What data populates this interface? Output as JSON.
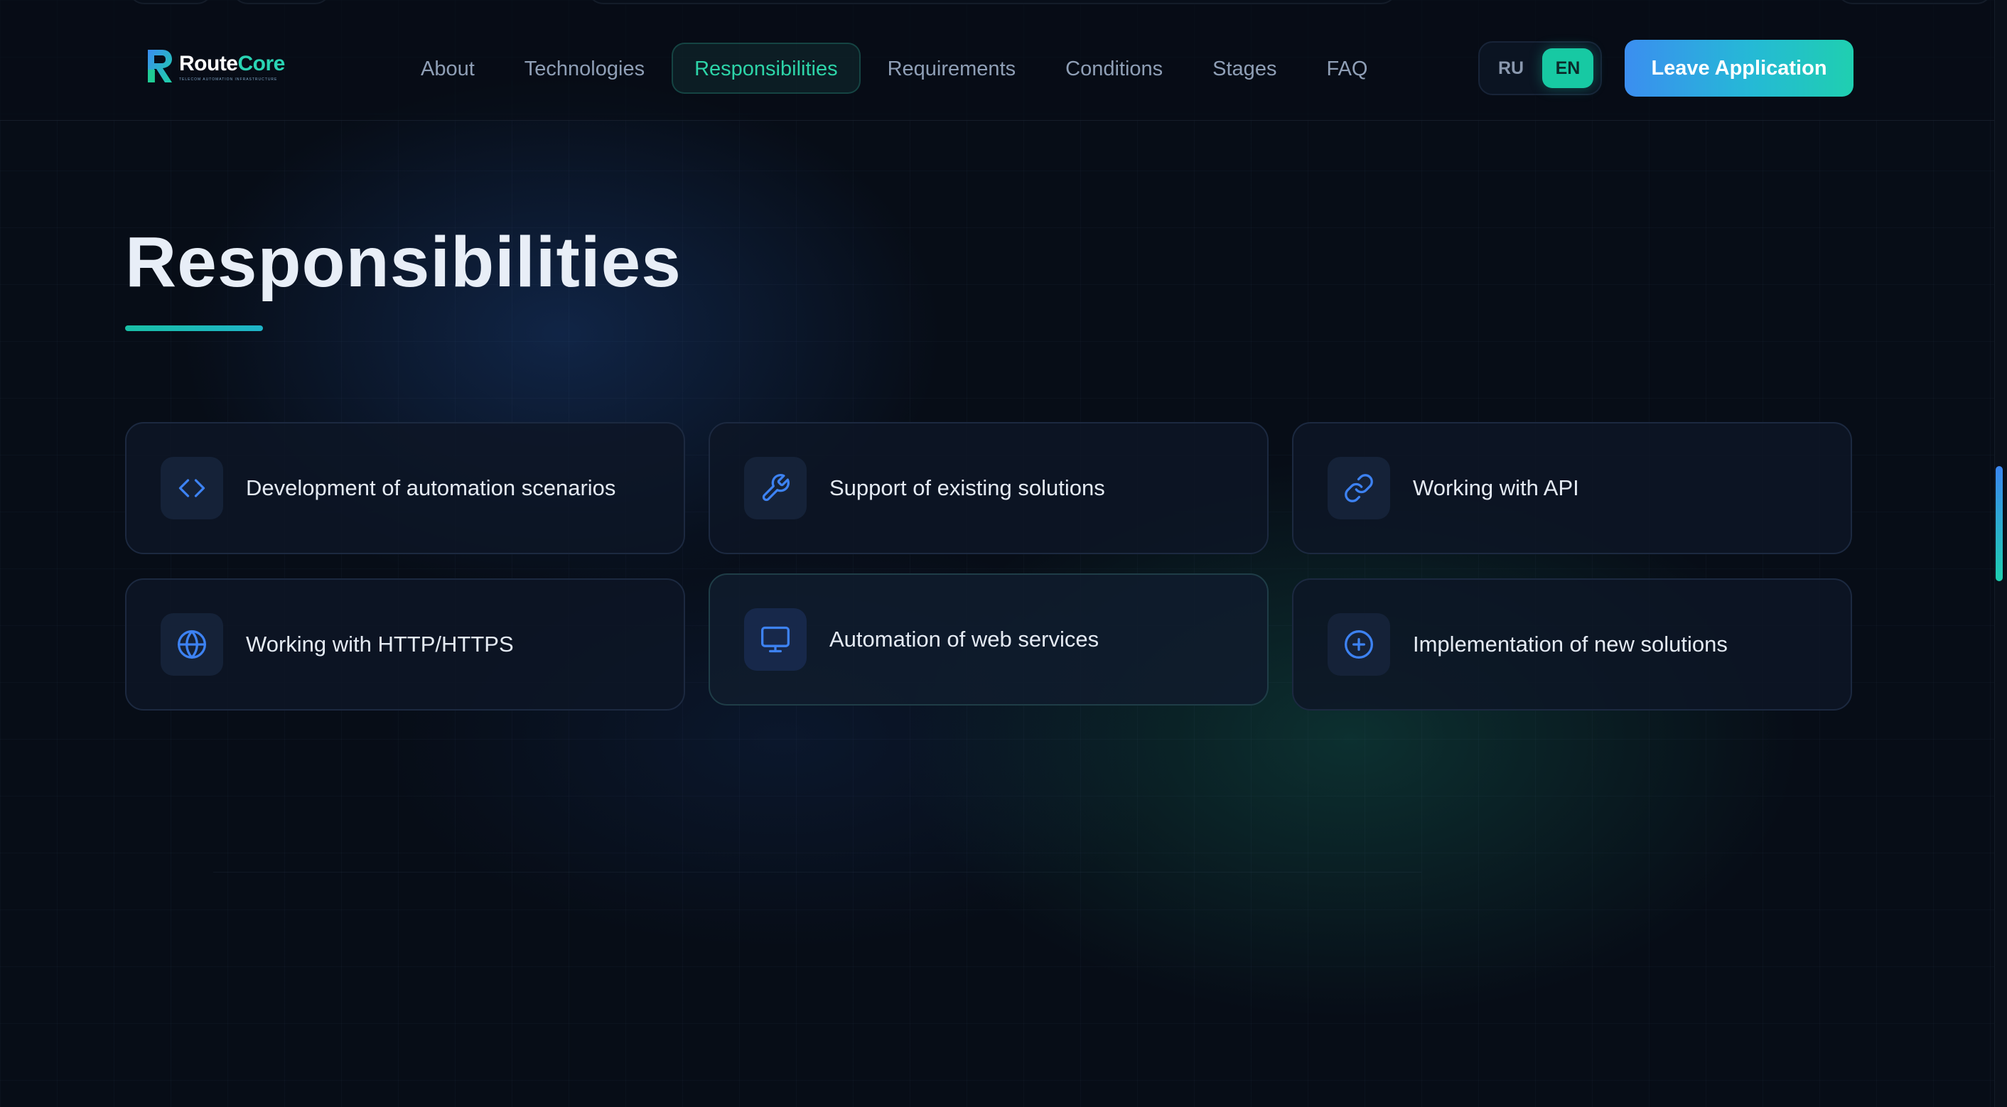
{
  "brand": {
    "name_part1": "Route",
    "name_part2": "Core",
    "tagline": "TELECOM AUTOMATION INFRASTRUCTURE"
  },
  "nav": {
    "items": [
      {
        "label": "About"
      },
      {
        "label": "Technologies"
      },
      {
        "label": "Responsibilities",
        "active": true
      },
      {
        "label": "Requirements"
      },
      {
        "label": "Conditions"
      },
      {
        "label": "Stages"
      },
      {
        "label": "FAQ"
      }
    ]
  },
  "lang": {
    "ru": "RU",
    "en": "EN",
    "active": "EN"
  },
  "cta": {
    "label": "Leave Application"
  },
  "section": {
    "title": "Responsibilities",
    "cards": [
      {
        "label": "Development of automation scenarios",
        "icon": "code-icon"
      },
      {
        "label": "Support of existing solutions",
        "icon": "wrench-icon"
      },
      {
        "label": "Working with API",
        "icon": "link-icon"
      },
      {
        "label": "Working with HTTP/HTTPS",
        "icon": "globe-icon"
      },
      {
        "label": "Automation of web services",
        "icon": "monitor-icon"
      },
      {
        "label": "Implementation of new solutions",
        "icon": "plus-circle-icon"
      }
    ]
  },
  "colors": {
    "accent_teal": "#17c9a3",
    "accent_blue": "#3b8ef0",
    "icon_blue": "#3d82f2",
    "background": "#070d17"
  }
}
